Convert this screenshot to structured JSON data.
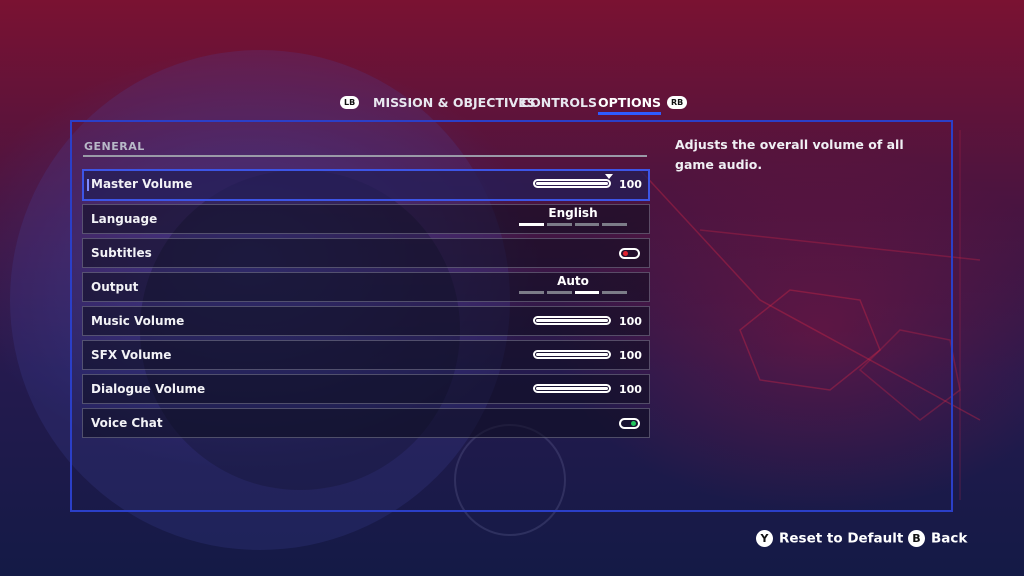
{
  "tabs": {
    "left_bumper": "LB",
    "right_bumper": "RB",
    "items": [
      {
        "label": "MISSION & OBJECTIVES",
        "active": false
      },
      {
        "label": "CONTROLS",
        "active": false
      },
      {
        "label": "OPTIONS",
        "active": true
      }
    ]
  },
  "section": {
    "title": "GENERAL"
  },
  "settings": [
    {
      "label": "Master Volume",
      "type": "slider",
      "value": "100",
      "level": 1.0,
      "selected": true
    },
    {
      "label": "Language",
      "type": "selector",
      "value": "English",
      "options_count": 4,
      "active_index": 0
    },
    {
      "label": "Subtitles",
      "type": "toggle",
      "state": "off"
    },
    {
      "label": "Output",
      "type": "selector",
      "value": "Auto",
      "options_count": 4,
      "active_index": 2
    },
    {
      "label": "Music Volume",
      "type": "slider",
      "value": "100",
      "level": 1.0
    },
    {
      "label": "SFX Volume",
      "type": "slider",
      "value": "100",
      "level": 1.0
    },
    {
      "label": "Dialogue Volume",
      "type": "slider",
      "value": "100",
      "level": 1.0
    },
    {
      "label": "Voice Chat",
      "type": "toggle",
      "state": "on"
    }
  ],
  "description": "Adjusts the overall volume of all game audio.",
  "footer": {
    "reset": {
      "glyph": "Y",
      "label": "Reset to Default"
    },
    "back": {
      "glyph": "B",
      "label": "Back"
    }
  },
  "colors": {
    "accent": "#2e5cff",
    "frame": "#2b3fc8",
    "toggle_off": "#e0202e",
    "toggle_on": "#22c55e"
  }
}
